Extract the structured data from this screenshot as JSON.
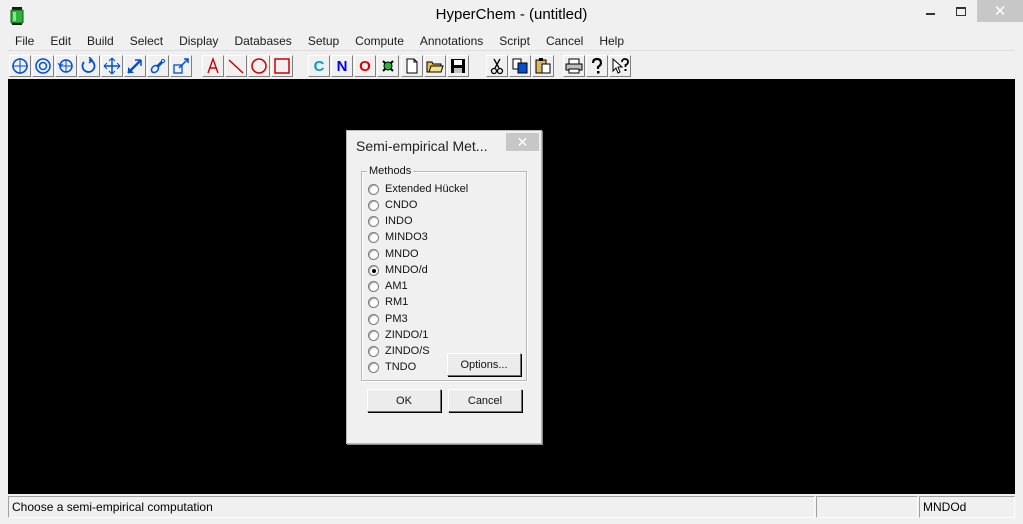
{
  "window": {
    "title": "HyperChem - (untitled)",
    "minimize": "",
    "maximize": "",
    "close": "✕"
  },
  "menu": [
    "File",
    "Edit",
    "Build",
    "Select",
    "Display",
    "Databases",
    "Setup",
    "Compute",
    "Annotations",
    "Script",
    "Cancel",
    "Help"
  ],
  "toolbar": {
    "text_tools": {
      "carbon": "C",
      "nitrogen": "N",
      "oxygen": "O"
    },
    "colors": {
      "carbon": "#00a0c8",
      "nitrogen": "#0000ff",
      "oxygen": "#e00000",
      "drawing": "#cc0000",
      "tool_blue": "#0050d0"
    }
  },
  "dialog": {
    "title": "Semi-empirical Met...",
    "close": "✕",
    "group_label": "Methods",
    "methods": [
      {
        "label": "Extended Hückel",
        "checked": false
      },
      {
        "label": "CNDO",
        "checked": false
      },
      {
        "label": "INDO",
        "checked": false
      },
      {
        "label": "MINDO3",
        "checked": false
      },
      {
        "label": "MNDO",
        "checked": false
      },
      {
        "label": "MNDO/d",
        "checked": true
      },
      {
        "label": "AM1",
        "checked": false
      },
      {
        "label": "RM1",
        "checked": false
      },
      {
        "label": "PM3",
        "checked": false
      },
      {
        "label": "ZINDO/1",
        "checked": false
      },
      {
        "label": "ZINDO/S",
        "checked": false
      },
      {
        "label": "TNDO",
        "checked": false
      }
    ],
    "options_button": "Options...",
    "ok_button": "OK",
    "cancel_button": "Cancel"
  },
  "status": {
    "message": "Choose a semi-empirical computation",
    "middle": "",
    "method": "MNDOd"
  }
}
